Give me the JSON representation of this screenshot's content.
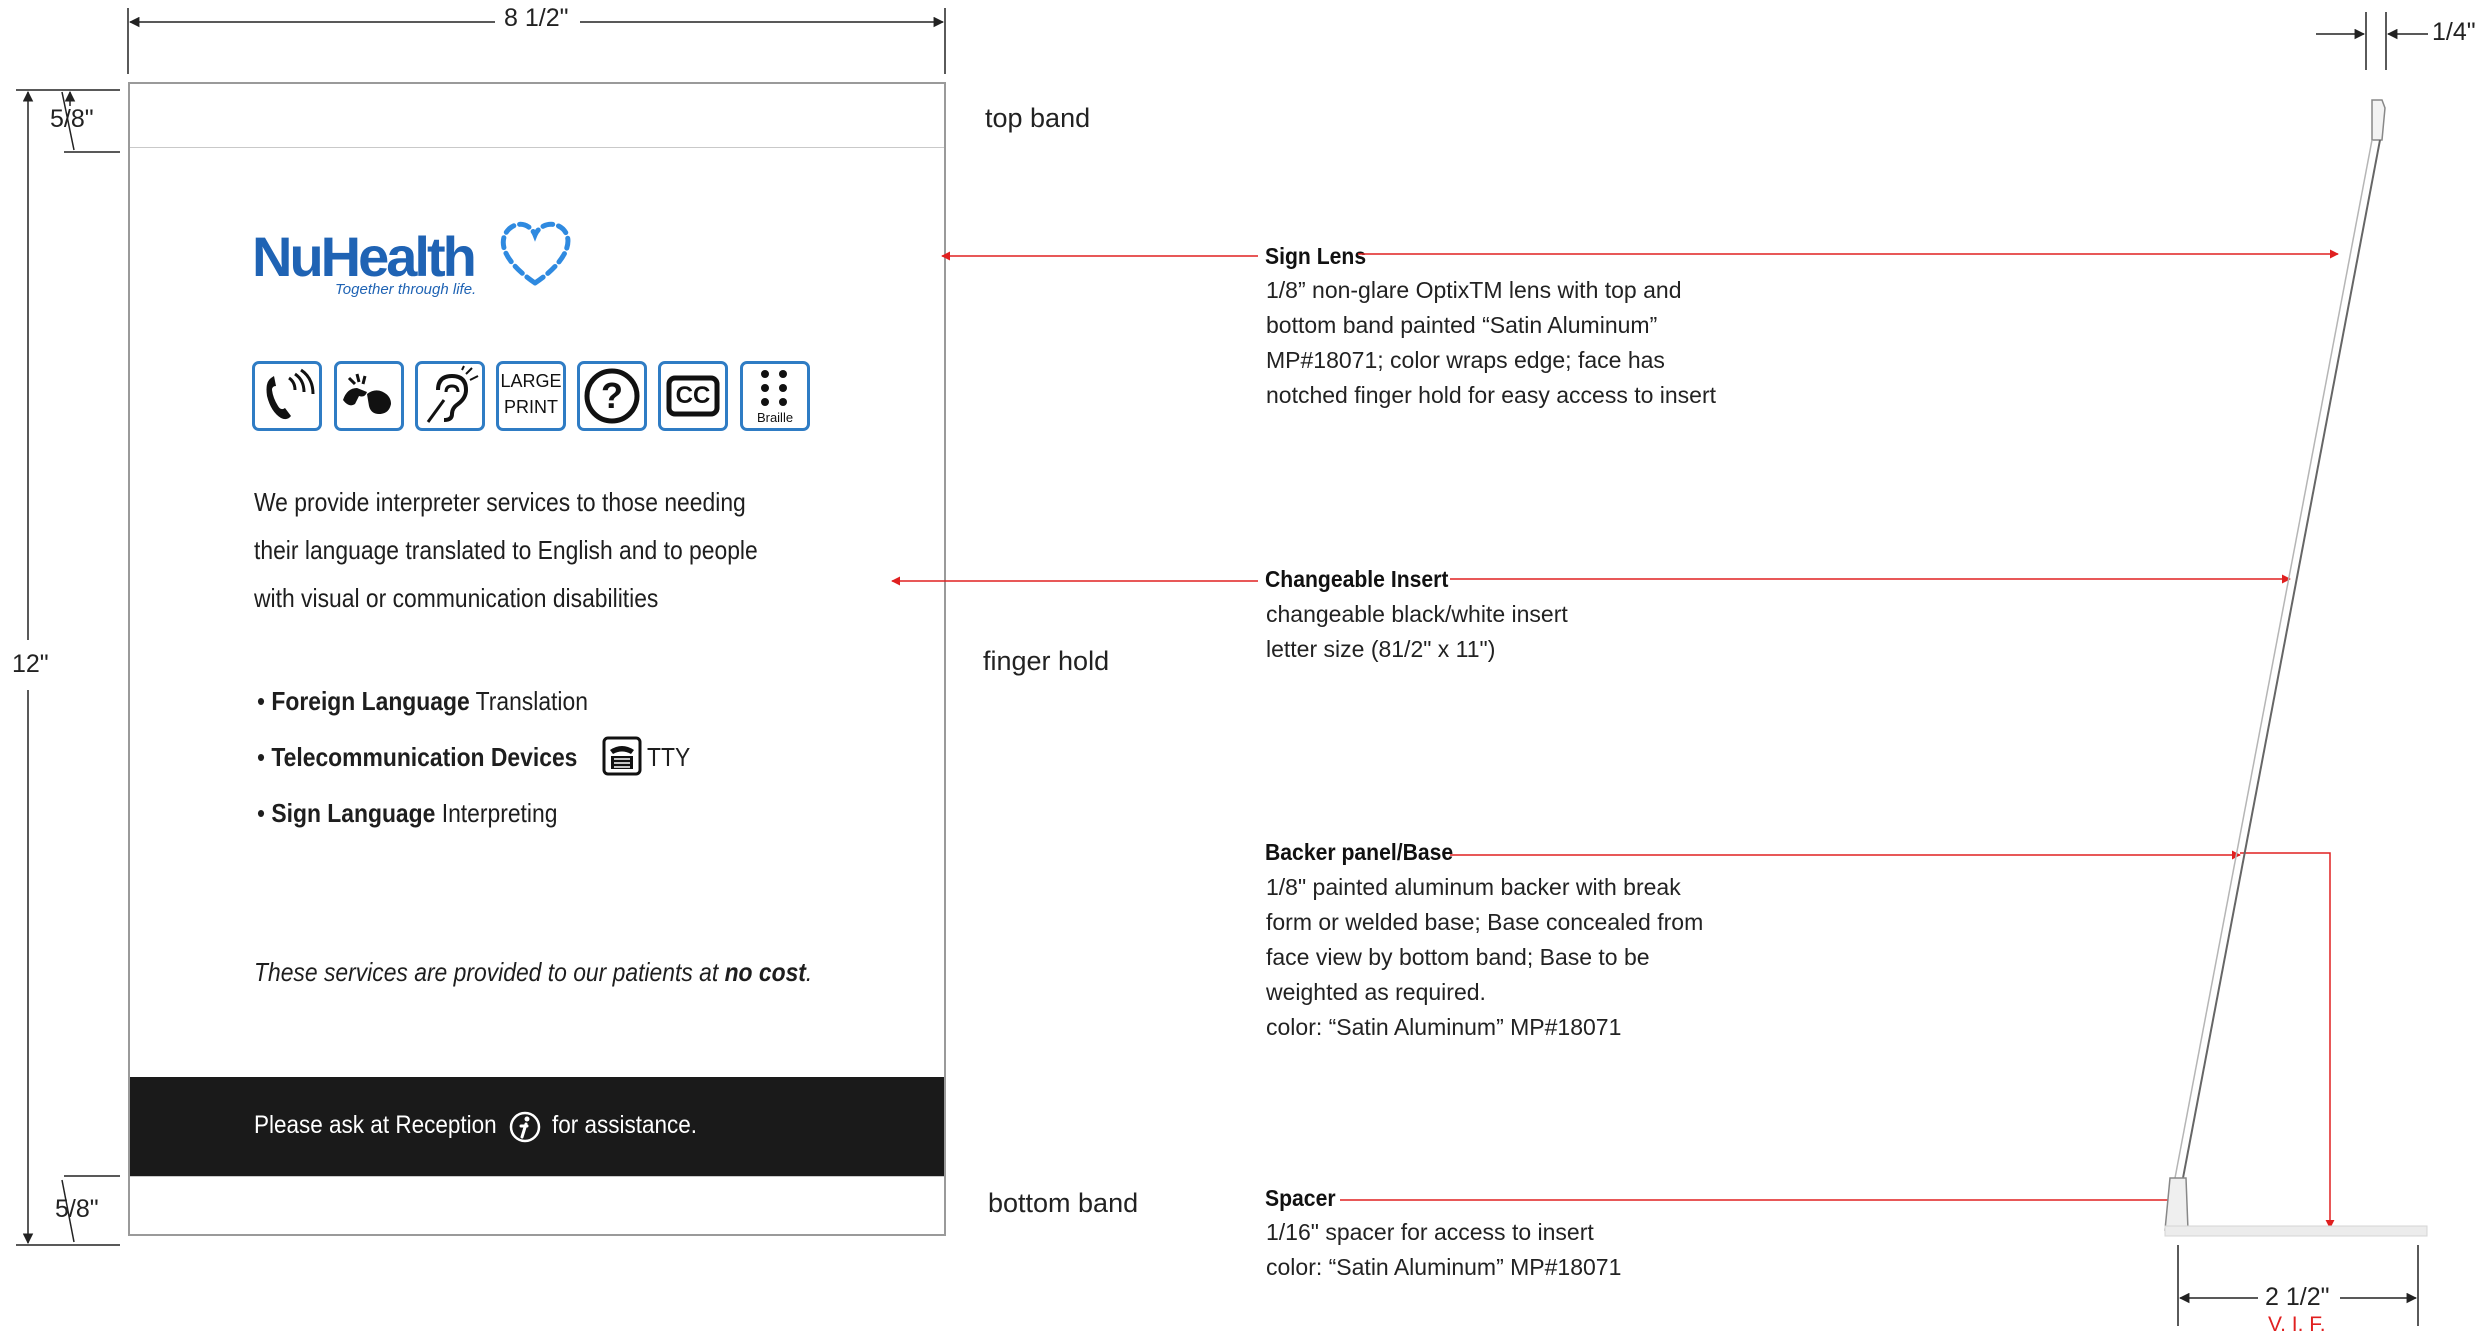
{
  "dimensions": {
    "sign_width": "8 1/2\"",
    "top_band": "5/8\"",
    "height": "12\"",
    "bottom_band": "5/8\"",
    "lens_thickness": "1/4\"",
    "base_depth": "2 1/2\"",
    "base_note": "V. I. F."
  },
  "band_labels": {
    "top": "top band",
    "finger": "finger hold",
    "bottom": "bottom band"
  },
  "sign_face": {
    "logo": {
      "name": "NuHealth",
      "tagline": "Together through life."
    },
    "icons": [
      {
        "name": "phone-volume-icon",
        "label": ""
      },
      {
        "name": "sign-language-icon",
        "label": ""
      },
      {
        "name": "hearing-assist-icon",
        "label": ""
      },
      {
        "name": "large-print-icon",
        "label": "LARGE PRINT",
        "lines": [
          "LARGE",
          "PRINT"
        ]
      },
      {
        "name": "help-icon",
        "label": "?"
      },
      {
        "name": "closed-caption-icon",
        "label": "CC"
      },
      {
        "name": "braille-icon",
        "label": "Braille"
      }
    ],
    "intro_lines": [
      "We provide interpreter services to those needing",
      "their language translated to English and to people",
      "with visual or communication disabilities"
    ],
    "services": [
      {
        "bold": "Foreign Language",
        "rest": " Translation",
        "icon": ""
      },
      {
        "bold": "Telecommunication Devices",
        "rest": "TTY",
        "icon": "tty-icon"
      },
      {
        "bold": "Sign Language",
        "rest": " Interpreting",
        "icon": ""
      }
    ],
    "cost_note": {
      "text": "These services are provided to our patients at ",
      "bold": "no cost",
      "end": "."
    },
    "assistance": {
      "before": "Please ask at Reception",
      "after": "for assistance.",
      "icon": "info-icon"
    }
  },
  "callouts": [
    {
      "title": "Sign Lens",
      "lines": [
        "1/8” non-glare OptixTM lens with top and",
        "bottom band painted “Satin Aluminum”",
        "MP#18071; color wraps edge; face has",
        "notched finger hold for easy access to insert"
      ]
    },
    {
      "title": "Changeable Insert",
      "lines": [
        "changeable black/white insert",
        "letter size (81/2\" x 11\")"
      ]
    },
    {
      "title": "Backer panel/Base",
      "lines": [
        "1/8\" painted aluminum backer with break",
        "form or welded base; Base concealed from",
        "face view by bottom band; Base to be",
        "weighted as required.",
        "color: “Satin Aluminum” MP#18071"
      ]
    },
    {
      "title": "Spacer",
      "lines": [
        "1/16\" spacer for access to insert",
        "color: “Satin Aluminum” MP#18071"
      ]
    }
  ],
  "colors": {
    "leader": "#e02020",
    "brand_blue": "#1f63b4",
    "band_black": "#1a1a1a"
  }
}
